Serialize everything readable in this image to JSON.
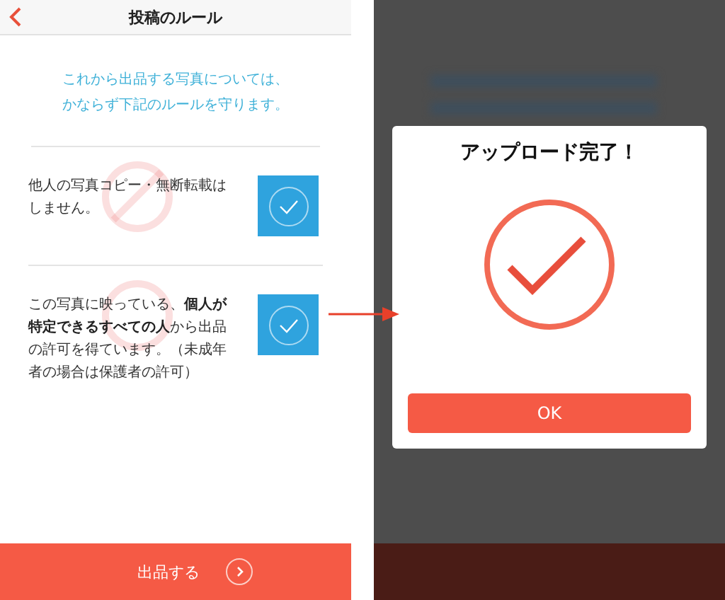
{
  "rules_screen": {
    "title": "投稿のルール",
    "intro_lines": [
      "これから出品する写真については、",
      "かならず下記のルールを守ります。"
    ],
    "rules": [
      {
        "text": "他人の写真コピー・無断転載はしません。",
        "checked": true
      },
      {
        "text": "この写真に映っている、**個人が特定できるすべての人**から出品の許可を得ています。（未成年者の場合は保護者の許可）",
        "checked": true
      }
    ],
    "submit_button": "出品する"
  },
  "dialog": {
    "title": "アップロード完了！",
    "button": "OK"
  }
}
